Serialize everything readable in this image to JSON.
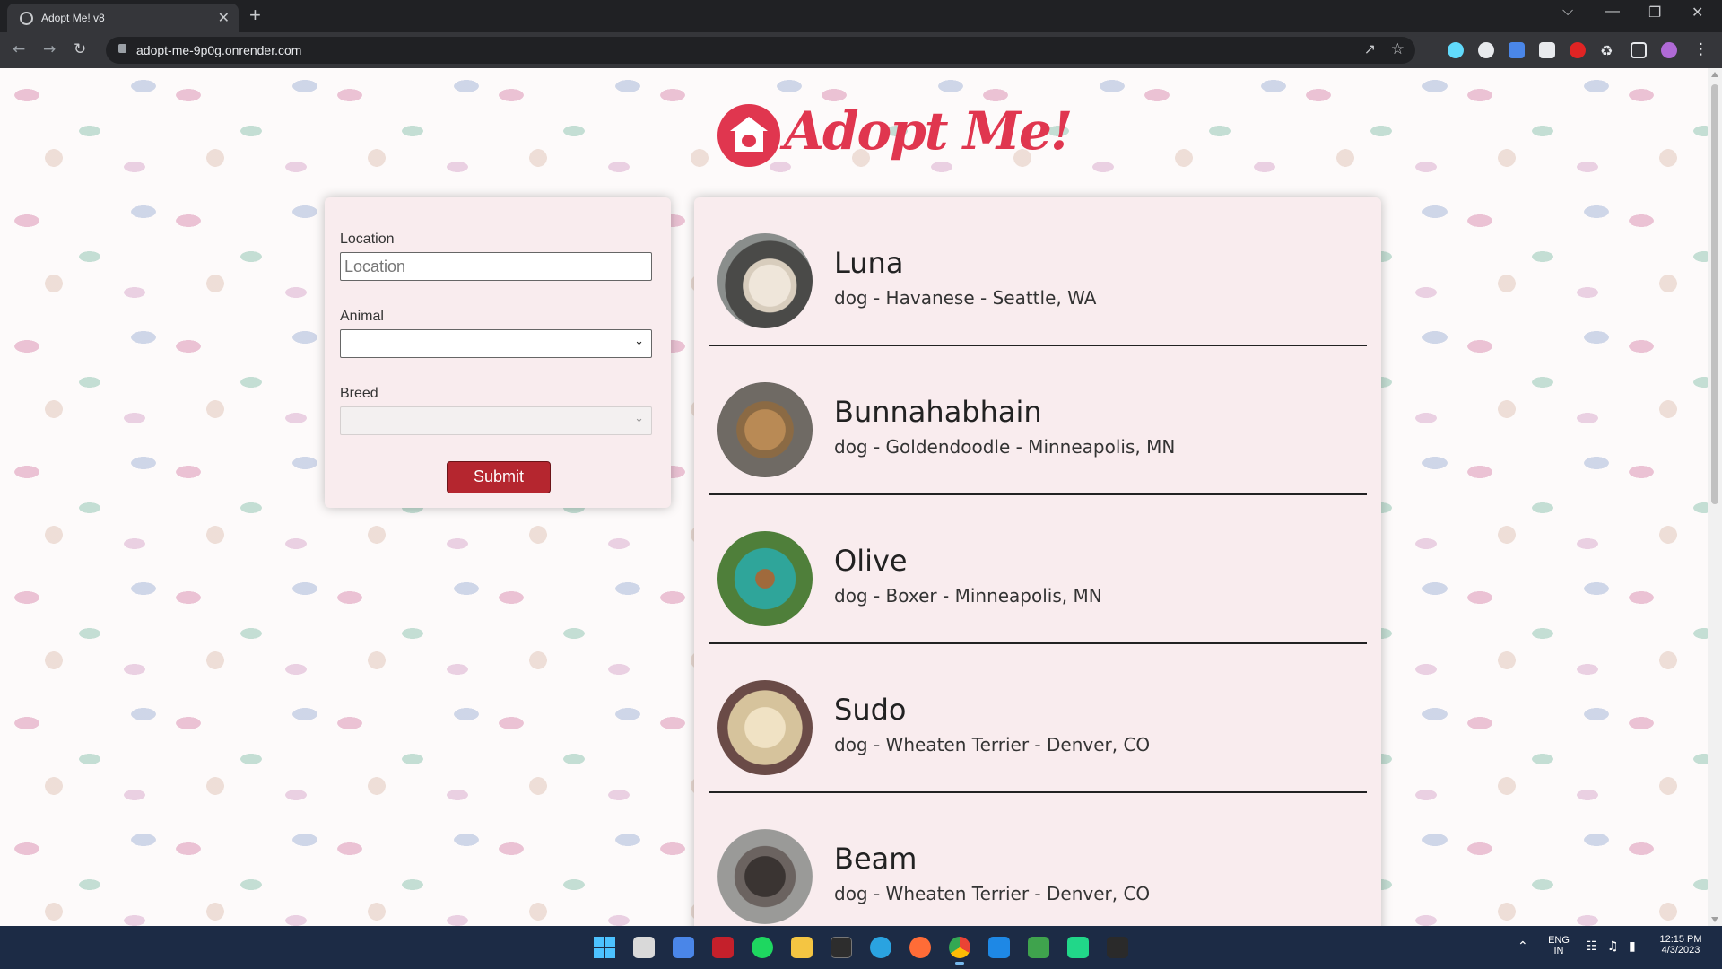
{
  "browser": {
    "tab_title": "Adopt Me! v8",
    "tab_close": "✕",
    "new_tab": "+",
    "url": "adopt-me-9p0g.onrender.com",
    "window_controls": [
      "⌵",
      "—",
      "❐",
      "✕"
    ]
  },
  "header": {
    "brand": "Adopt Me!",
    "brand_color": "#e0364f"
  },
  "search": {
    "location_label": "Location",
    "location_placeholder": "Location",
    "location_value": "",
    "animal_label": "Animal",
    "animal_value": "",
    "breed_label": "Breed",
    "breed_value": "",
    "breed_disabled": true,
    "submit_label": "Submit",
    "submit_color": "#b5262f"
  },
  "results": [
    {
      "name": "Luna",
      "description": "dog - Havanese - Seattle, WA",
      "photo": "white-fluffy-dog-photo"
    },
    {
      "name": "Bunnahabhain",
      "description": "dog - Goldendoodle - Minneapolis, MN",
      "photo": "tan-curly-dog-photo"
    },
    {
      "name": "Olive",
      "description": "dog - Boxer - Minneapolis, MN",
      "photo": "dog-on-chair-photo"
    },
    {
      "name": "Sudo",
      "description": "dog - Wheaten Terrier - Denver, CO",
      "photo": "wheaten-terrier-photo"
    },
    {
      "name": "Beam",
      "description": "dog - Wheaten Terrier - Denver, CO",
      "photo": "dark-shaggy-dog-photo"
    }
  ],
  "taskbar": {
    "apps": [
      "start",
      "task-view",
      "store",
      "media",
      "spotify",
      "file-explorer",
      "terminal",
      "telegram",
      "postman",
      "chrome",
      "vscode",
      "app-green",
      "pycharm",
      "epic-games"
    ],
    "lang": "ENG",
    "region": "IN",
    "time": "12:15 PM",
    "date": "4/3/2023"
  }
}
